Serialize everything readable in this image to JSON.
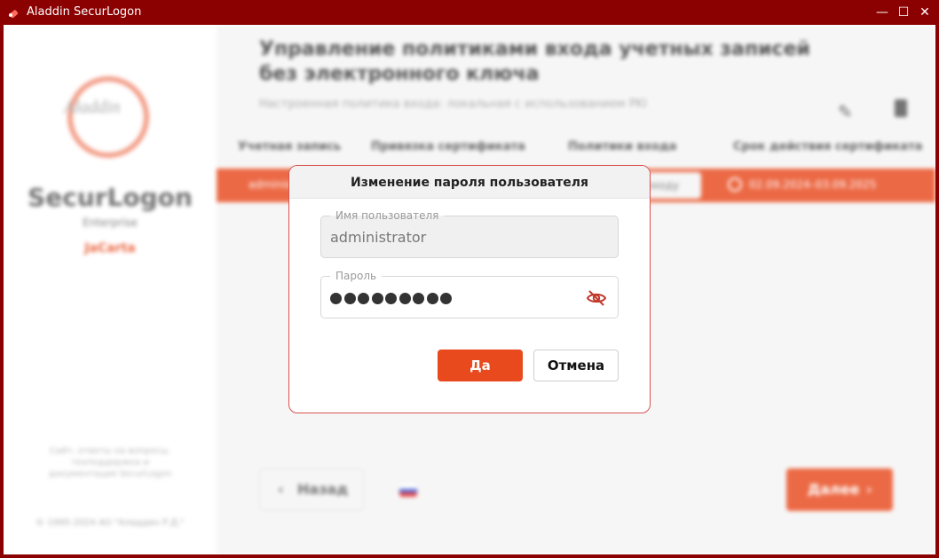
{
  "window": {
    "title": "Aladdin SecurLogon",
    "minimize_glyph": "—",
    "maximize_glyph": "☐",
    "close_glyph": "✕",
    "frame_color": "#8b0000"
  },
  "sidebar": {
    "logo_text": "Aladdin",
    "product_name": "SecurLogon",
    "edition": "Enterprise",
    "brand": "JaCarta",
    "support_text": "Сайт, ответы на вопросы, техподдержка и документация SecurLogon",
    "copyright": "© 1995-2024 АО \"Аладдин Р.Д.\""
  },
  "main": {
    "heading": "Управление политиками входа учетных записей без электронного ключа",
    "subheading": "Настроенная политика входа: локальная с использованием PKI",
    "columns": [
      "Учетная запись",
      "Привязка сертификата",
      "Политики входа",
      "Срок действия сертификата"
    ],
    "row": {
      "account": "administrator",
      "policy": "входу",
      "validity": "02.09.2024–03.09.2025"
    },
    "back_label": "Назад",
    "next_label": "Далее"
  },
  "dialog": {
    "title": "Изменение пароля пользователя",
    "username_label": "Имя пользователя",
    "username_value": "administrator",
    "password_label": "Пароль",
    "password_mask_count": 9,
    "confirm_label": "Да",
    "cancel_label": "Отмена"
  },
  "colors": {
    "accent": "#e8491d",
    "dialog_border": "#d9534f"
  },
  "icons": [
    "app-key-icon",
    "edit-icon",
    "trash-icon",
    "clock-icon",
    "chevron-left-icon",
    "chevron-right-icon",
    "flag-ru-icon",
    "eye-off-icon"
  ]
}
